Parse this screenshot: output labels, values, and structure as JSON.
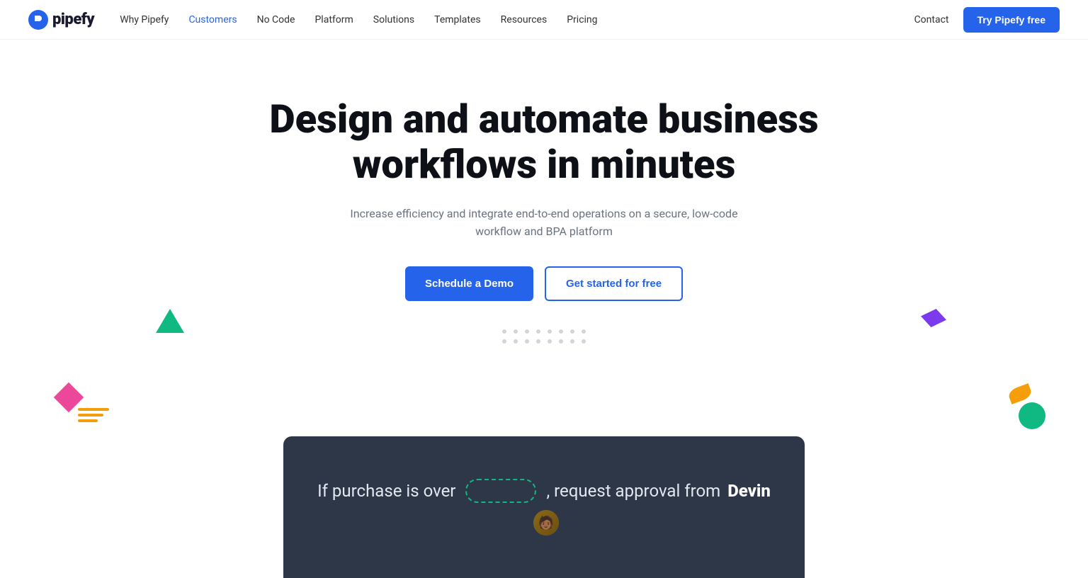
{
  "logo": {
    "text": "pipefy"
  },
  "nav": {
    "links": [
      {
        "label": "Why Pipefy",
        "active": false
      },
      {
        "label": "Customers",
        "active": true
      },
      {
        "label": "No Code",
        "active": false
      },
      {
        "label": "Platform",
        "active": false
      },
      {
        "label": "Solutions",
        "active": false
      },
      {
        "label": "Templates",
        "active": false
      },
      {
        "label": "Resources",
        "active": false
      },
      {
        "label": "Pricing",
        "active": false
      }
    ],
    "contact_label": "Contact",
    "try_label": "Try Pipefy free"
  },
  "hero": {
    "headline_line1": "Design and automate business",
    "headline_line2": "workflows in minutes",
    "subtitle": "Increase efficiency and integrate end-to-end operations on a secure, low-code workflow and BPA platform",
    "btn_demo": "Schedule a Demo",
    "btn_free": "Get started for free"
  },
  "dark_section": {
    "workflow_text_before": "If purchase is over",
    "workflow_text_after": ", request approval from",
    "workflow_name": "Devin"
  }
}
